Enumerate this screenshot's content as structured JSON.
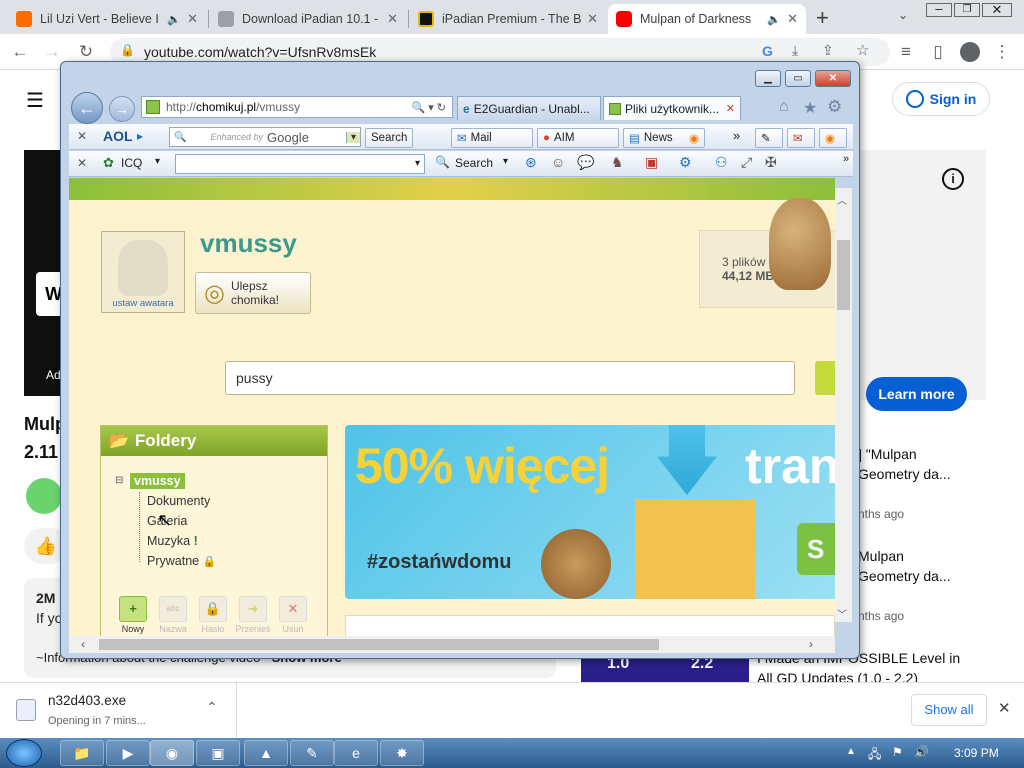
{
  "chrome": {
    "tabs": [
      {
        "label": "Lil Uzi Vert - Believe I",
        "favicon_color": "#ff6d00"
      },
      {
        "label": "Download iPadian 10.1 -",
        "favicon_color": "#9aa0a6"
      },
      {
        "label": "iPadian Premium - The Be",
        "favicon_color": "#111111"
      },
      {
        "label": "Mulpan of Darkness",
        "favicon_color": "#ff0000"
      }
    ],
    "new_tab": "+",
    "url": "youtube.com/watch?v=UfsnRv8msEk"
  },
  "youtube": {
    "sign_in": "Sign in",
    "learn_more": "Learn more",
    "title_partial": "Mulp",
    "title_line2": "2.11",
    "ad_label": "Ad",
    "ad_logo": "Wi",
    "count_partial": "2M",
    "desc_partial": "If yo",
    "desc_line": "~Information about the challenge video~",
    "show_more": "Show more",
    "recommended": [
      {
        "title1": "] \"Mulpan",
        "title2": "Geometry da...",
        "meta": "nths ago"
      },
      {
        "title1": "Mulpan",
        "title2": "Geometry da...",
        "meta": "nths ago"
      },
      {
        "title1": "I Made an IMPOSSIBLE Level in",
        "title2": "All GD Updates (1.0 - 2.2)",
        "thumb1": "1.0",
        "thumb2": "2.2"
      }
    ]
  },
  "download": {
    "filename": "n32d403.exe",
    "status": "Opening in 7 mins...",
    "show_all": "Show all"
  },
  "taskbar": {
    "time": "3:09 PM"
  },
  "ie": {
    "url_prefix": "http://",
    "url_domain": "chomikuj.pl",
    "url_path": "/vmussy",
    "tabs": [
      "E2Guardian - Unabl...",
      "Pliki użytkownik..."
    ],
    "aol": "AOL",
    "google_hint": "Enhanced by",
    "google": "Google",
    "search_btn": "Search",
    "mail": "Mail",
    "aim": "AIM",
    "news": "News",
    "icq": "ICQ",
    "search2": "Search",
    "more": "»"
  },
  "chomikuj": {
    "username": "vmussy",
    "avatar_caption": "ustaw awatara",
    "upgrade_line1": "Ulepsz",
    "upgrade_line2": "chomika!",
    "files_count": "3 plików",
    "files_size": "44,12 MB",
    "search_value": "pussy",
    "folders_title": "Foldery",
    "folders_root": "vmussy",
    "folders": [
      "Dokumenty",
      "Galeria",
      "Muzyka",
      "Prywatne"
    ],
    "actions": [
      "Nowy",
      "Nazwa",
      "Hasło",
      "Przenieś",
      "Usuń"
    ],
    "banner_text": "50% więcej",
    "banner_text2": "tran",
    "banner_hashtag": "#zostańwdomu",
    "banner_btn": "S"
  }
}
